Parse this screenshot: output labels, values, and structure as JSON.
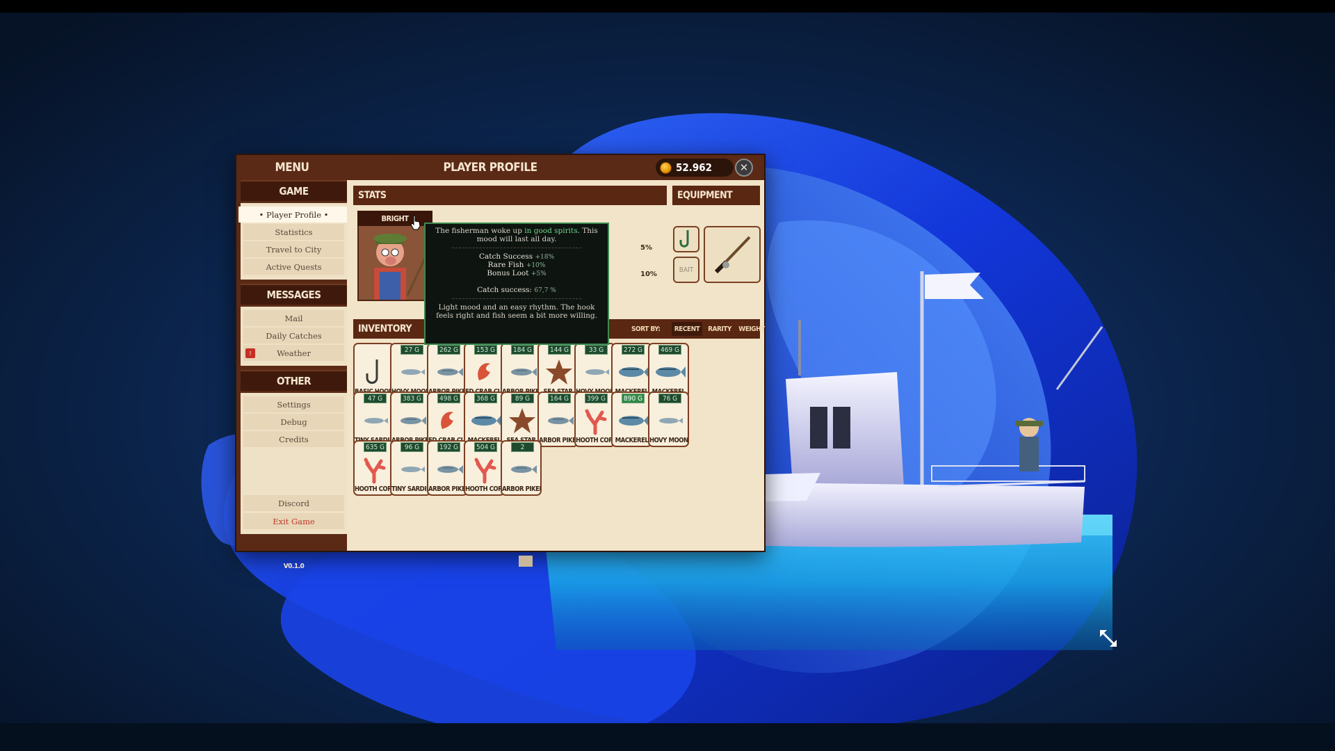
{
  "window": {
    "menu_title": "MENU",
    "title": "PLAYER PROFILE",
    "coins": "52.962",
    "close_icon": "close-icon",
    "version": "V0.1.0"
  },
  "sidebar": {
    "game": {
      "header": "GAME",
      "items": [
        "• Player Profile •",
        "Statistics",
        "Travel to City",
        "Active Quests"
      ]
    },
    "messages": {
      "header": "MESSAGES",
      "items": [
        "Mail",
        "Daily Catches",
        "Weather"
      ],
      "weather_badge": "!"
    },
    "other": {
      "header": "OTHER",
      "items": [
        "Settings",
        "Debug",
        "Credits",
        "Discord",
        "Exit Game"
      ]
    }
  },
  "stats": {
    "header": "STATS",
    "mood": "BRIGHT",
    "bars": [
      {
        "percent": "5%",
        "filled": 5
      },
      {
        "percent": "10%",
        "filled": 6
      }
    ]
  },
  "equipment": {
    "header": "EQUIPMENT",
    "hook_icon": "hook-icon",
    "bait_label": "BAIT",
    "rod_icon": "fishing-rod-icon"
  },
  "inventory": {
    "header": "INVENTORY",
    "sort_label": "SORT BY:",
    "sort_options": [
      "RECENT",
      "RARITY",
      "WEIGHT"
    ],
    "active_sort": "RECENT",
    "items": [
      {
        "weight": "",
        "name": "BASIC HOOK",
        "icon": "hook"
      },
      {
        "weight": "27 G",
        "name": "HOVY MOONLI",
        "icon": "fish-small"
      },
      {
        "weight": "262 G",
        "name": "ARBOR PIKELE",
        "icon": "fish"
      },
      {
        "weight": "153 G",
        "name": "ED CRAB CLAW",
        "icon": "crab-claw"
      },
      {
        "weight": "184 G",
        "name": "ARBOR PIKELE",
        "icon": "fish"
      },
      {
        "weight": "144 G",
        "name": "SEA STAR",
        "icon": "star"
      },
      {
        "weight": "33 G",
        "name": "HOVY MOONLI",
        "icon": "fish-small"
      },
      {
        "weight": "272 G",
        "name": "MACKEREL",
        "icon": "fish-big"
      },
      {
        "weight": "469 G",
        "name": "MACKEREL",
        "icon": "fish-big"
      },
      {
        "weight": "47 G",
        "name": "TINY SARDINE",
        "icon": "fish-small"
      },
      {
        "weight": "383 G",
        "name": "ARBOR PIKELE",
        "icon": "fish"
      },
      {
        "weight": "498 G",
        "name": "ED CRAB CLAW",
        "icon": "crab-claw"
      },
      {
        "weight": "368 G",
        "name": "MACKEREL",
        "icon": "fish-big"
      },
      {
        "weight": "89 G",
        "name": "SEA STAR",
        "icon": "star"
      },
      {
        "weight": "164 G",
        "name": "ARBOR PIKELE",
        "icon": "fish"
      },
      {
        "weight": "399 G",
        "name": "HOOTH CORAL O",
        "icon": "coral"
      },
      {
        "weight": "890 G",
        "name": "MACKEREL",
        "icon": "fish-big",
        "highlight": true
      },
      {
        "weight": "76 G",
        "name": "HOVY MOONLI",
        "icon": "fish-small"
      },
      {
        "weight": "635 G",
        "name": "HOOTH CORAL O",
        "icon": "coral"
      },
      {
        "weight": "96 G",
        "name": "TINY SARDINE",
        "icon": "fish-small"
      },
      {
        "weight": "192 G",
        "name": "ARBOR PIKELE",
        "icon": "fish"
      },
      {
        "weight": "504 G",
        "name": "HOOTH CORAL O",
        "icon": "coral"
      },
      {
        "weight": "2",
        "name": "ARBOR PIKELE",
        "icon": "fish"
      }
    ]
  },
  "tooltip": {
    "line1_pre": "The fisherman woke up ",
    "line1_hl": "in good spirits",
    "line1_post": ". This mood will last all day.",
    "effects": [
      {
        "label": "Catch Success",
        "value": "+18%"
      },
      {
        "label": "Rare Fish",
        "value": "+10%"
      },
      {
        "label": "Bonus Loot",
        "value": "+5%"
      }
    ],
    "catch_label": "Catch success:",
    "catch_value": "67,7 %",
    "flavor": "Light mood and an easy rhythm. The hook feels right and fish seem a bit more willing."
  },
  "colors": {
    "window_brown": "#5a2a16",
    "panel_cream": "#f2e4c8",
    "tooltip_green": "#3c8a52",
    "desktop_blue": "#1f4fe0"
  }
}
